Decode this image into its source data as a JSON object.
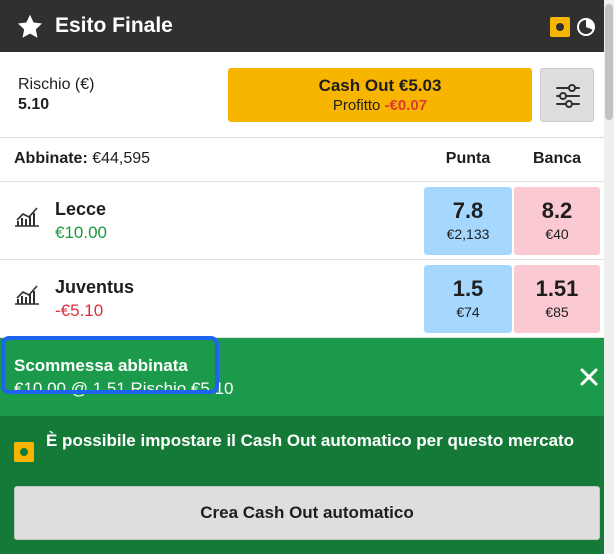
{
  "header": {
    "title": "Esito Finale",
    "star_icon": "star-icon",
    "cashout_icon": "cashout-available-icon",
    "timer_icon": "timer-icon",
    "colors": {
      "background": "#303030",
      "accent": "#f7b500"
    }
  },
  "risk": {
    "label": "Rischio (€)",
    "value": "5.10"
  },
  "cashout": {
    "label": "Cash Out €5.03",
    "profit_label": "Profitto",
    "profit_value": "-€0.07",
    "colors": {
      "button": "#f7b500",
      "negative": "#e03a2e"
    }
  },
  "settings": {
    "icon": "sliders-icon"
  },
  "market": {
    "matched_label": "Abbinate:",
    "matched_value": "€44,595",
    "back_header": "Punta",
    "lay_header": "Banca",
    "runners": [
      {
        "name": "Lecce",
        "pl": "€10.00",
        "pl_sign": "positive",
        "back_price": "7.8",
        "back_size": "€2,133",
        "lay_price": "8.2",
        "lay_size": "€40"
      },
      {
        "name": "Juventus",
        "pl": "-€5.10",
        "pl_sign": "negative",
        "back_price": "1.5",
        "back_size": "€74",
        "lay_price": "1.51",
        "lay_size": "€85"
      }
    ],
    "colors": {
      "back": "#a6d8ff",
      "lay": "#fac9d1",
      "positive": "#1a9a3c",
      "negative": "#d9303a"
    }
  },
  "bet": {
    "title": "Scommessa abbinata",
    "description": "€10.00 @ 1.51 Rischio €5.10",
    "close_icon": "close-icon",
    "colors": {
      "background": "#1a9a4a",
      "highlight": "#1e64f0"
    }
  },
  "auto_cashout": {
    "message": "È possibile impostare il Cash Out automatico per questo mercato",
    "button_label": "Crea Cash Out automatico",
    "colors": {
      "background": "#157a38"
    }
  }
}
